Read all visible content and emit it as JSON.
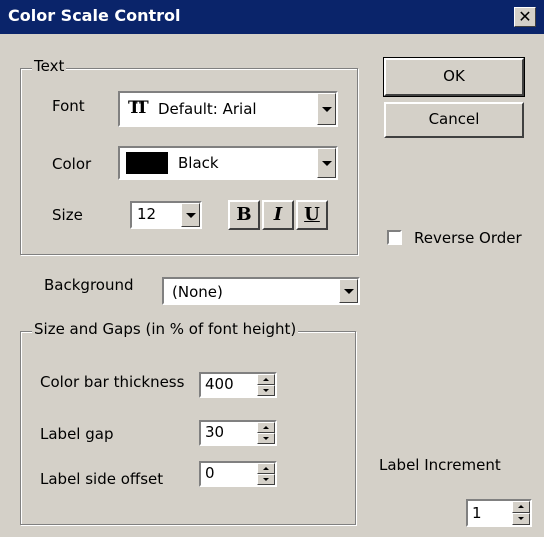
{
  "window": {
    "title": "Color Scale Control",
    "close_glyph": "✕"
  },
  "text_group": {
    "label": "Text",
    "font_label": "Font",
    "font_value": "Default: Arial",
    "font_icon": "truetype-font-icon",
    "color_label": "Color",
    "color_value": "Black",
    "color_swatch": "#000000",
    "size_label": "Size",
    "size_value": "12",
    "bold_glyph": "B",
    "italic_glyph": "I",
    "underline_glyph": "U"
  },
  "buttons": {
    "ok": "OK",
    "cancel": "Cancel"
  },
  "reverse_order": {
    "label": "Reverse Order",
    "checked": false
  },
  "background": {
    "label": "Background",
    "value": "(None)"
  },
  "gaps_group": {
    "label": "Size and Gaps (in % of font height)",
    "thickness_label": "Color bar thickness",
    "thickness_value": "400",
    "label_gap_label": "Label gap",
    "label_gap_value": "30",
    "side_offset_label": "Label side offset",
    "side_offset_value": "0"
  },
  "label_increment": {
    "label": "Label Increment",
    "value": "1"
  }
}
